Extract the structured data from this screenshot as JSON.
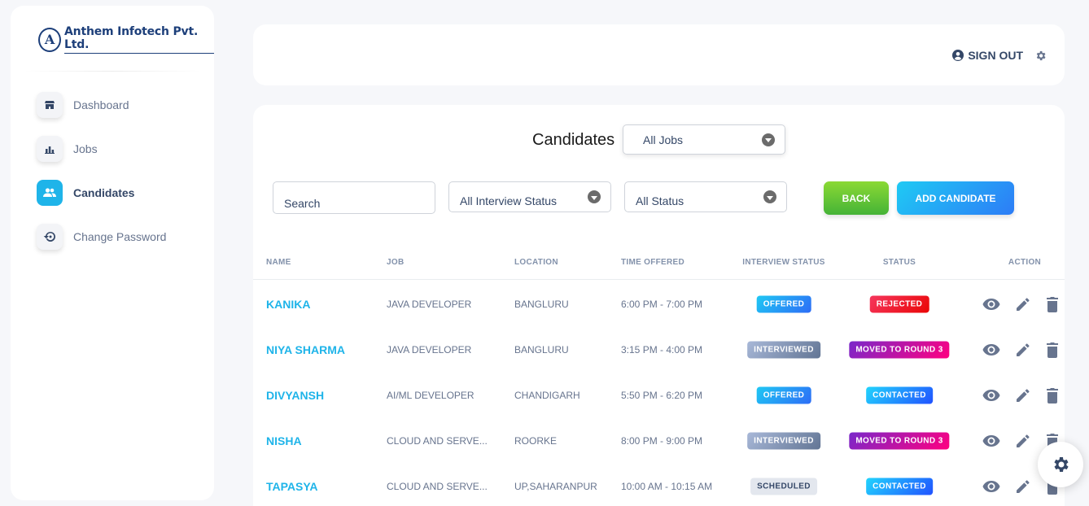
{
  "sidebar": {
    "logo_text": "Anthem Infotech Pvt. Ltd.",
    "logo_letter": "A",
    "items": [
      {
        "label": "Dashboard",
        "icon": "store-icon",
        "active": false
      },
      {
        "label": "Jobs",
        "icon": "chart-icon",
        "active": false
      },
      {
        "label": "Candidates",
        "icon": "people-icon",
        "active": true
      },
      {
        "label": "Change Password",
        "icon": "restore-icon",
        "active": false
      }
    ]
  },
  "header": {
    "sign_out_label": "SIGN OUT"
  },
  "main": {
    "title": "Candidates",
    "jobs_filter": "All Jobs",
    "search_placeholder": "Search",
    "interview_filter": "All Interview Status",
    "status_filter": "All Status",
    "back_label": "BACK",
    "add_label": "ADD CANDIDATE"
  },
  "table": {
    "headers": {
      "name": "NAME",
      "job": "JOB",
      "location": "LOCATION",
      "time": "TIME OFFERED",
      "interview": "INTERVIEW STATUS",
      "status": "STATUS",
      "action": "ACTION"
    },
    "rows": [
      {
        "name": "KANIKA",
        "job": "JAVA DEVELOPER",
        "location": "BANGLURU",
        "time": "6:00 PM - 7:00 PM",
        "interview": "OFFERED",
        "status": "REJECTED"
      },
      {
        "name": "NIYA SHARMA",
        "job": "JAVA DEVELOPER",
        "location": "BANGLURU",
        "time": "3:15 PM - 4:00 PM",
        "interview": "INTERVIEWED",
        "status": "MOVED TO ROUND 3"
      },
      {
        "name": "DIVYANSH",
        "job": "AI/ML DEVELOPER",
        "location": "CHANDIGARH",
        "time": "5:50 PM - 6:20 PM",
        "interview": "OFFERED",
        "status": "CONTACTED"
      },
      {
        "name": "NISHA",
        "job": "CLOUD AND SERVE...",
        "location": "ROORKE",
        "time": "8:00 PM - 9:00 PM",
        "interview": "INTERVIEWED",
        "status": "MOVED TO ROUND 3"
      },
      {
        "name": "TAPASYA",
        "job": "CLOUD AND SERVE...",
        "location": "UP,SAHARANPUR",
        "time": "10:00 AM - 10:15 AM",
        "interview": "SCHEDULED",
        "status": "CONTACTED"
      }
    ]
  },
  "colors": {
    "accent": "#1fb4e9",
    "offered": "#1f8ef1",
    "interviewed": "#8392ab",
    "scheduled": "#e3e7ee",
    "rejected": "#ea0606",
    "moved": "#d81b9a",
    "contacted": "#1da1f2"
  }
}
